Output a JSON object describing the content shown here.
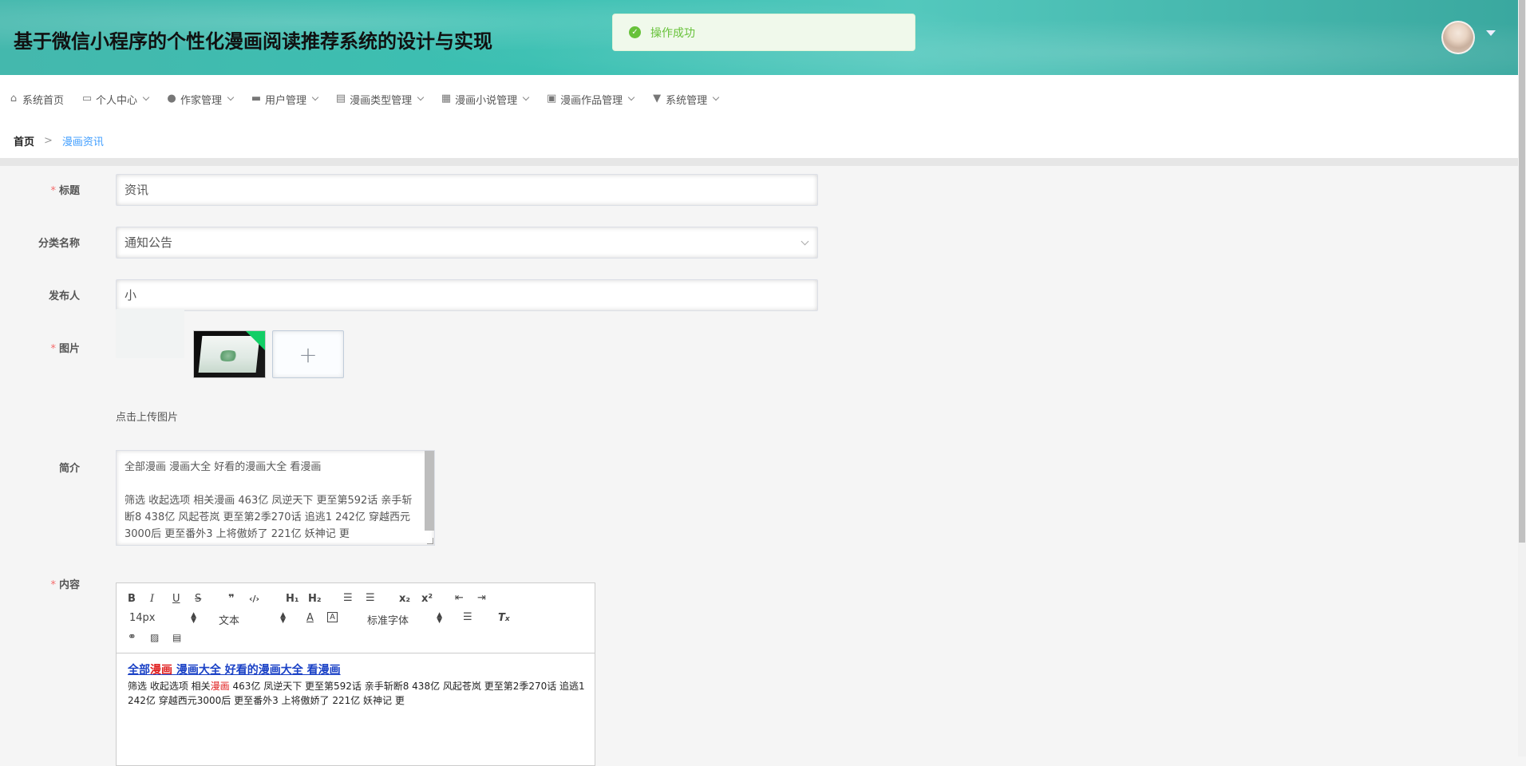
{
  "header": {
    "title": "基于微信小程序的个性化漫画阅读推荐系统的设计与实现"
  },
  "toast": {
    "message": "操作成功"
  },
  "nav": {
    "items": [
      {
        "label": "系统首页",
        "icon": "home-icon",
        "has_dropdown": false
      },
      {
        "label": "个人中心",
        "icon": "profile-card-icon",
        "has_dropdown": true
      },
      {
        "label": "作家管理",
        "icon": "user-icon",
        "has_dropdown": true
      },
      {
        "label": "用户管理",
        "icon": "briefcase-icon",
        "has_dropdown": true
      },
      {
        "label": "漫画类型管理",
        "icon": "clipboard-icon",
        "has_dropdown": true
      },
      {
        "label": "漫画小说管理",
        "icon": "grid-icon",
        "has_dropdown": true
      },
      {
        "label": "漫画作品管理",
        "icon": "comment-icon",
        "has_dropdown": true
      },
      {
        "label": "系统管理",
        "icon": "podium-icon",
        "has_dropdown": true
      }
    ]
  },
  "breadcrumb": {
    "home": "首页",
    "separator": ">",
    "current": "漫画资讯"
  },
  "form": {
    "title_label": "标题",
    "title_value": "资讯",
    "category_label": "分类名称",
    "category_value": "通知公告",
    "publisher_label": "发布人",
    "publisher_value": "小",
    "image_label": "图片",
    "upload_tip": "点击上传图片",
    "intro_label": "简介",
    "intro_value": "全部漫画 漫画大全 好看的漫画大全 看漫画\n\n筛选 收起选项 相关漫画 463亿 凤逆天下 更至第592话 亲手斩断8 438亿 风起苍岚 更至第2季270话 追逃1 242亿 穿越西元3000后 更至番外3 上将傲娇了 221亿 妖神记 更",
    "content_label": "内容",
    "required_mark": "*"
  },
  "editor": {
    "font_size": "14px",
    "block_format": "文本",
    "font_family": "标准字体",
    "toolbar": {
      "bold": "B",
      "italic": "I",
      "underline": "U",
      "strike": "S",
      "quote": "❞",
      "code": "‹/›",
      "h1": "H₁",
      "h2": "H₂",
      "subscript": "x₂",
      "superscript": "x²"
    },
    "content": {
      "headline_part1": "全部",
      "headline_hl": "漫画",
      "headline_part2": " 漫画大全 好看的漫画大全 看漫画",
      "body_part1": "筛选 收起选项 相关",
      "body_hl": "漫画",
      "body_part2": " 463亿 凤逆天下 更至第592话 亲手斩断8 438亿 风起苍岚 更至第2季270话 追逃1 242亿 穿越西元3000后 更至番外3 上将傲娇了 221亿 妖神记 更"
    }
  },
  "colors": {
    "accent": "#409eff",
    "success": "#67c23a",
    "required": "#f56c6c",
    "header_teal": "#44b8ad"
  }
}
